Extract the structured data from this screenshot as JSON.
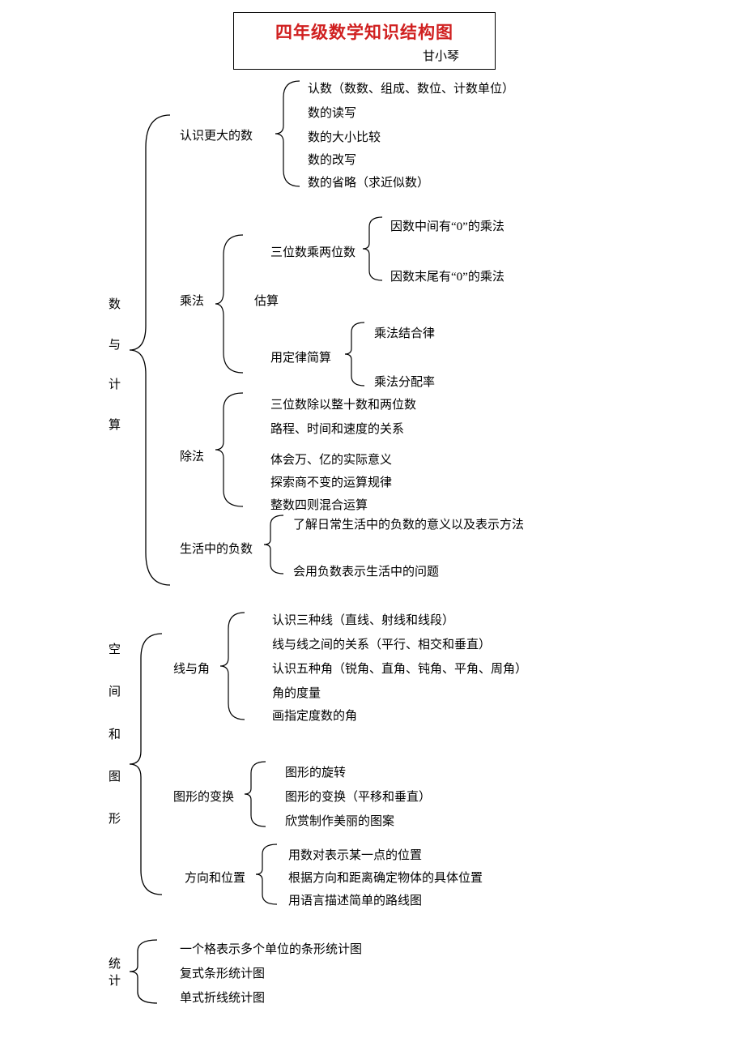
{
  "title": "四年级数学知识结构图",
  "author": "甘小琴",
  "root1": {
    "c0": "数",
    "c1": "与",
    "c2": "计",
    "c3": "算"
  },
  "root2": {
    "c0": "空",
    "c1": "间",
    "c2": "和",
    "c3": "图",
    "c4": "形"
  },
  "root3": {
    "c0": "统",
    "c1": "计"
  },
  "n1": {
    "a": "认识更大的数",
    "a1": "认数（数数、组成、数位、计数单位）",
    "a2": "数的读写",
    "a3": "数的大小比较",
    "a4": "数的改写",
    "a5": "数的省略（求近似数）",
    "b": "乘法",
    "b1": "三位数乘两位数",
    "b1a": "因数中间有“0”的乘法",
    "b1b": "因数末尾有“0”的乘法",
    "b2": "估算",
    "b3": "用定律简算",
    "b3a": "乘法结合律",
    "b3b": "乘法分配率",
    "c": "除法",
    "c1": "三位数除以整十数和两位数",
    "c2": "路程、时间和速度的关系",
    "c3": "体会万、亿的实际意义",
    "c4": "探索商不变的运算规律",
    "c5": "整数四则混合运算",
    "d": "生活中的负数",
    "d1": "了解日常生活中的负数的意义以及表示方法",
    "d2": "会用负数表示生活中的问题"
  },
  "n2": {
    "a": "线与角",
    "a1": "认识三种线（直线、射线和线段）",
    "a2": "线与线之间的关系（平行、相交和垂直）",
    "a3": "认识五种角（锐角、直角、钝角、平角、周角）",
    "a4": "角的度量",
    "a5": "画指定度数的角",
    "b": "图形的变换",
    "b1": "图形的旋转",
    "b2": "图形的变换（平移和垂直）",
    "b3": "欣赏制作美丽的图案",
    "c": "方向和位置",
    "c1": "用数对表示某一点的位置",
    "c2": "根据方向和距离确定物体的具体位置",
    "c3": "用语言描述简单的路线图"
  },
  "n3": {
    "a": "一个格表示多个单位的条形统计图",
    "b": "复式条形统计图",
    "c": "单式折线统计图"
  }
}
